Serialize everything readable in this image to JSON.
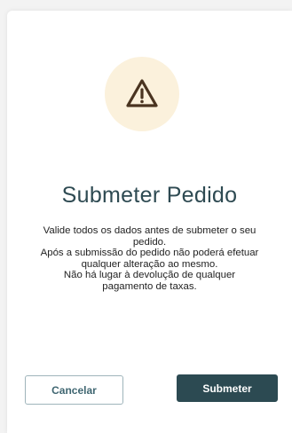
{
  "dialog": {
    "icon": "warning-triangle-icon",
    "title": "Submeter Pedido",
    "message_lines": [
      "Valide todos os dados antes de submeter o seu",
      "pedido.",
      "Após a submissão do pedido não poderá efetuar",
      "qualquer alteração ao mesmo.",
      "Não há lugar à devolução de qualquer",
      "pagamento de taxas."
    ],
    "cancel_label": "Cancelar",
    "submit_label": "Submeter"
  },
  "colors": {
    "primary": "#2c4a52",
    "icon_bg": "#fbf1dc",
    "icon_stroke": "#4a3420"
  }
}
